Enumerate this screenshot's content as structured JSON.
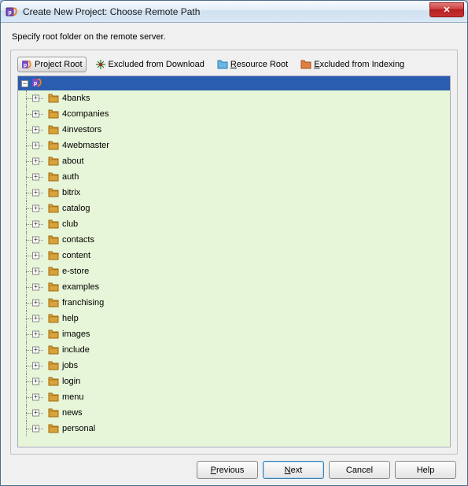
{
  "window": {
    "title": "Create New Project: Choose Remote Path"
  },
  "instruction": "Specify root folder on the remote server.",
  "toolbar": {
    "project_root": "Project Root",
    "excluded_download": "Excluded from Download",
    "resource_root": "Resource Root",
    "excluded_indexing": "Excluded from Indexing"
  },
  "tree": {
    "root_label": "",
    "folders": [
      "4banks",
      "4companies",
      "4investors",
      "4webmaster",
      "about",
      "auth",
      "bitrix",
      "catalog",
      "club",
      "contacts",
      "content",
      "e-store",
      "examples",
      "franchising",
      "help",
      "images",
      "include",
      "jobs",
      "login",
      "menu",
      "news",
      "personal"
    ]
  },
  "buttons": {
    "previous": "Previous",
    "next": "Next",
    "cancel": "Cancel",
    "help": "Help"
  },
  "colors": {
    "selection": "#2a5db0",
    "tree_bg": "#e7f5d8",
    "folder": "#d9a23a"
  }
}
